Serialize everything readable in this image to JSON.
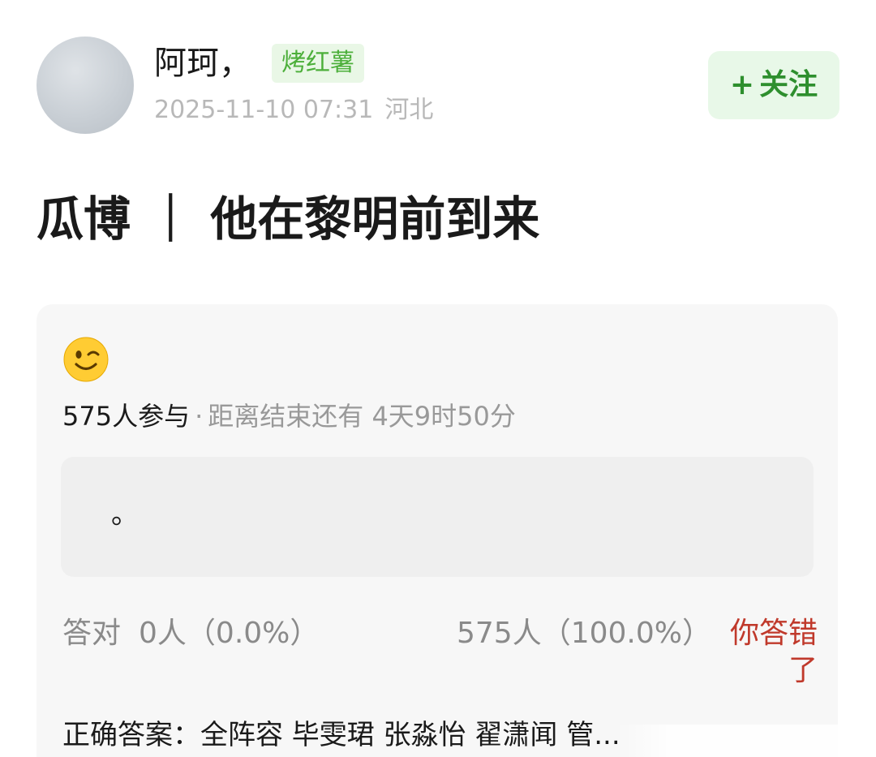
{
  "post": {
    "username": "阿珂，",
    "user_tag": "烤红薯",
    "timestamp": "2025-11-10 07:31",
    "location": "河北",
    "follow_plus": "+",
    "follow_label": "关注",
    "title": "瓜博 ｜ 他在黎明前到来"
  },
  "quiz": {
    "icon": "winking-face-emoji",
    "icon_glyph": "😉",
    "participants": "575人参与",
    "separator": "·",
    "time_remaining": "距离结束还有 4天9时50分",
    "option_text": "。",
    "correct_label": "答对",
    "correct_count": "0人（0.0%）",
    "other_count": "575人（100.0%）",
    "wrong_notice": "你答错了",
    "answer_line": "正确答案：全阵容 毕雯珺 张淼怡 翟潇闻 管..."
  },
  "colors": {
    "tag_bg": "#e9f7e6",
    "tag_text": "#4caf3a",
    "follow_bg": "#e8f8e8",
    "follow_text": "#2e8f2e",
    "wrong_text": "#c0392b",
    "card_bg": "#f7f7f7"
  }
}
